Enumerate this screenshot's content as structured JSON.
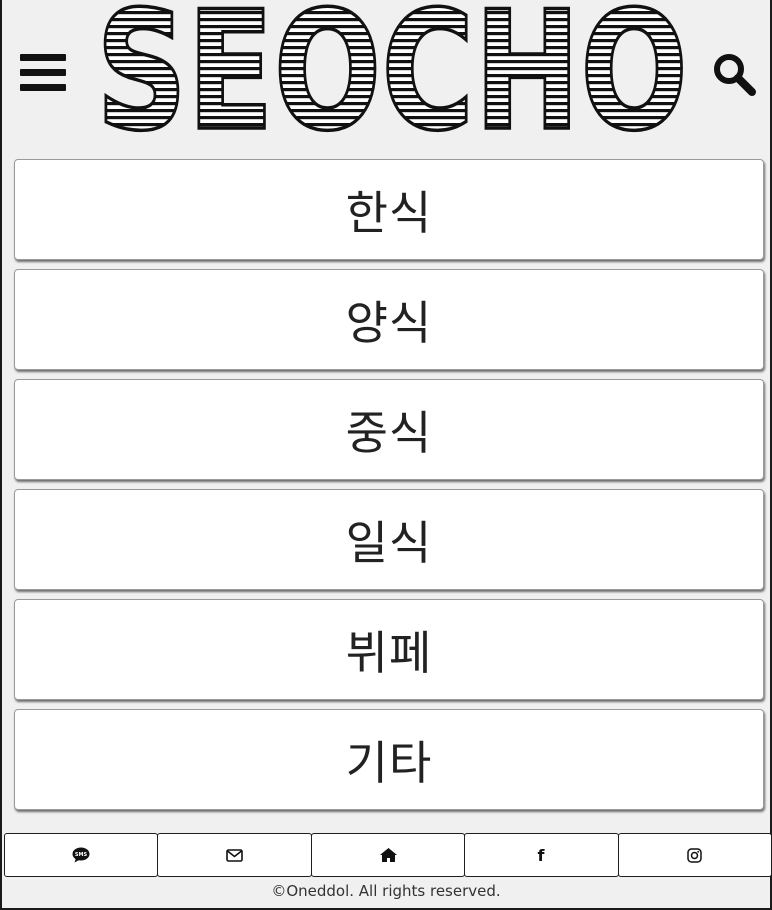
{
  "header": {
    "logo_text": "SEOCHO",
    "menu_icon": "hamburger-menu-icon",
    "search_icon": "search-icon"
  },
  "categories": [
    {
      "label": "한식"
    },
    {
      "label": "양식"
    },
    {
      "label": "중식"
    },
    {
      "label": "일식"
    },
    {
      "label": "뷔페"
    },
    {
      "label": "기타"
    }
  ],
  "footer": {
    "buttons": [
      {
        "icon": "sms-icon",
        "label": "SMS"
      },
      {
        "icon": "mail-icon"
      },
      {
        "icon": "home-icon"
      },
      {
        "icon": "facebook-icon",
        "label": "f"
      },
      {
        "icon": "instagram-icon"
      }
    ],
    "copyright": "©Oneddol. All rights reserved."
  },
  "colors": {
    "background": "#f0f0f0",
    "button_bg": "#ffffff",
    "text": "#222222",
    "icon": "#111111"
  }
}
